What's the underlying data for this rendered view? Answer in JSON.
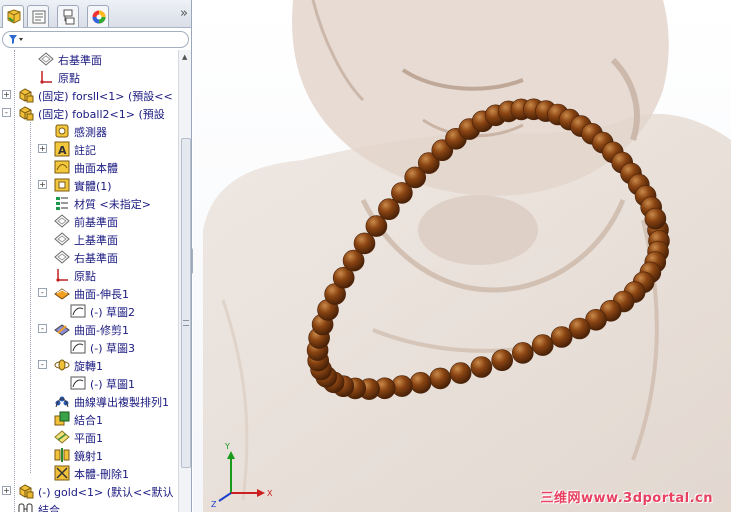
{
  "panel_tabs": [
    {
      "name": "feature-manager",
      "icon": "feature-tree-icon"
    },
    {
      "name": "property-manager",
      "icon": "property-icon"
    },
    {
      "name": "configuration-manager",
      "icon": "configuration-icon"
    },
    {
      "name": "display-manager",
      "icon": "appearance-icon"
    }
  ],
  "more_tabs_glyph": "»",
  "filter_icon": "filter-icon",
  "tree": [
    {
      "label": "右基準面",
      "icon": "plane-icon"
    },
    {
      "label": "原點",
      "icon": "origin-icon"
    },
    {
      "label": "(固定) forsll<1> (預設<<",
      "icon": "part-icon",
      "expand": "+"
    },
    {
      "label": "(固定) foball2<1> (預設",
      "icon": "part-icon",
      "expand": "-"
    },
    {
      "label": "感測器",
      "icon": "sensor-icon"
    },
    {
      "label": "註記",
      "icon": "annotation-icon",
      "expand": "+"
    },
    {
      "label": "曲面本體",
      "icon": "surface-body-icon"
    },
    {
      "label": "實體(1)",
      "icon": "solid-body-icon",
      "expand": "+"
    },
    {
      "label": "材質 <未指定>",
      "icon": "material-icon"
    },
    {
      "label": "前基準面",
      "icon": "plane-icon"
    },
    {
      "label": "上基準面",
      "icon": "plane-icon"
    },
    {
      "label": "右基準面",
      "icon": "plane-icon"
    },
    {
      "label": "原點",
      "icon": "origin-icon"
    },
    {
      "label": "曲面-伸長1",
      "icon": "surface-extrude-icon",
      "expand": "-"
    },
    {
      "label": "(-) 草圖2",
      "icon": "sketch-icon"
    },
    {
      "label": "曲面-修剪1",
      "icon": "surface-trim-icon",
      "expand": "-"
    },
    {
      "label": "(-) 草圖3",
      "icon": "sketch-icon"
    },
    {
      "label": "旋轉1",
      "icon": "revolve-icon",
      "expand": "-"
    },
    {
      "label": "(-) 草圖1",
      "icon": "sketch-icon"
    },
    {
      "label": "曲線導出複製排列1",
      "icon": "curve-pattern-icon"
    },
    {
      "label": "結合1",
      "icon": "combine-icon"
    },
    {
      "label": "平面1",
      "icon": "plane-feature-icon"
    },
    {
      "label": "鏡射1",
      "icon": "mirror-icon"
    },
    {
      "label": "本體-刪除1",
      "icon": "delete-body-icon"
    },
    {
      "label": "(-) gold<1> (默认<<默认",
      "icon": "part-icon",
      "expand": "+"
    },
    {
      "label": "結合",
      "icon": "mates-icon"
    }
  ],
  "watermark": "三维网www.3dportal.cn",
  "colors": {
    "bead": "#8b4513",
    "bead_highlight": "#c07a3a",
    "bead_shadow": "#4a2208",
    "buddha_tint": "#e6d9d0",
    "tree_text": "#1a1a80",
    "watermark": "#e84060"
  }
}
